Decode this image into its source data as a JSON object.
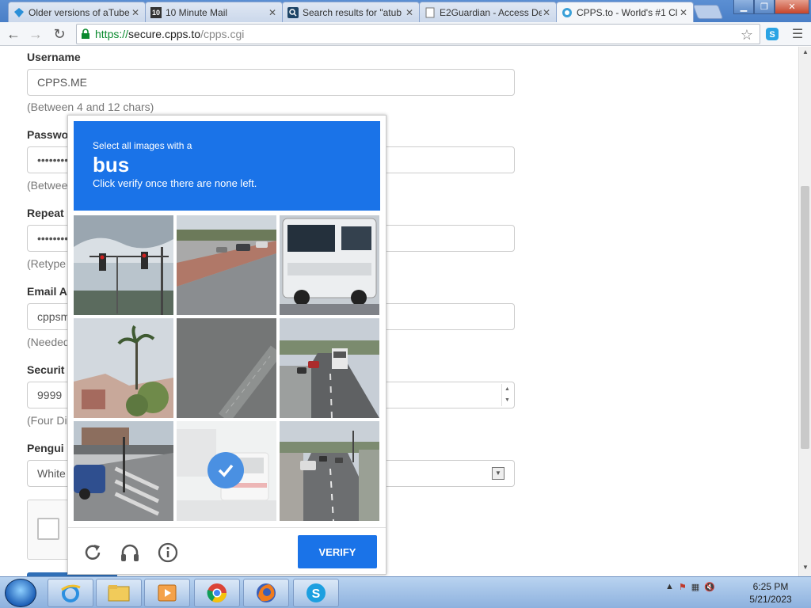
{
  "browser": {
    "tabs": [
      {
        "title": "Older versions of aTube",
        "favicon": "diamond-icon"
      },
      {
        "title": "10 Minute Mail",
        "favicon": "10-icon"
      },
      {
        "title": "Search results for \"atub",
        "favicon": "search-icon"
      },
      {
        "title": "E2Guardian - Access De",
        "favicon": "page-icon"
      },
      {
        "title": "CPPS.to - World's #1 Cl",
        "favicon": "cpps-icon",
        "active": true
      }
    ],
    "url_proto": "https://",
    "url_host": "secure.cpps.to",
    "url_path": "/cpps.cgi"
  },
  "form": {
    "username_label": "Username",
    "username_value": "CPPS.ME",
    "username_help": "(Between 4 and 12 chars)",
    "password_label": "Passwo",
    "password_value": "••••••••",
    "password_help": "(Betwee",
    "repeat_label": "Repeat",
    "repeat_value": "••••••••",
    "repeat_help": "(Retype",
    "email_label": "Email A",
    "email_value": "cppsm",
    "email_help": "(Needed",
    "security_label": "Securit",
    "security_value": "9999",
    "security_help": "(Four Di",
    "penguin_label": "Pengui",
    "penguin_value": "White"
  },
  "challenge": {
    "intro": "Select all images with a",
    "object": "bus",
    "note": "Click verify once there are none left.",
    "verify_label": "VERIFY",
    "tiles": [
      {
        "scene": "traffic-lights",
        "selected": false
      },
      {
        "scene": "road-cars",
        "selected": false
      },
      {
        "scene": "bus-closeup",
        "selected": false
      },
      {
        "scene": "palm-houses",
        "selected": false
      },
      {
        "scene": "aerial-road",
        "selected": false
      },
      {
        "scene": "street-bus",
        "selected": false
      },
      {
        "scene": "crosswalk-car",
        "selected": false
      },
      {
        "scene": "storefront-bus",
        "selected": true
      },
      {
        "scene": "wide-street",
        "selected": false
      }
    ]
  },
  "taskbar": {
    "time": "6:25 PM",
    "date": "5/21/2023",
    "apps": [
      "internet-explorer-icon",
      "file-explorer-icon",
      "media-player-icon",
      "chrome-icon",
      "firefox-icon",
      "skype-icon"
    ]
  },
  "colors": {
    "challenge_blue": "#1a73e8",
    "url_green": "#0b8a2f",
    "check_blue": "#4a90e2"
  }
}
